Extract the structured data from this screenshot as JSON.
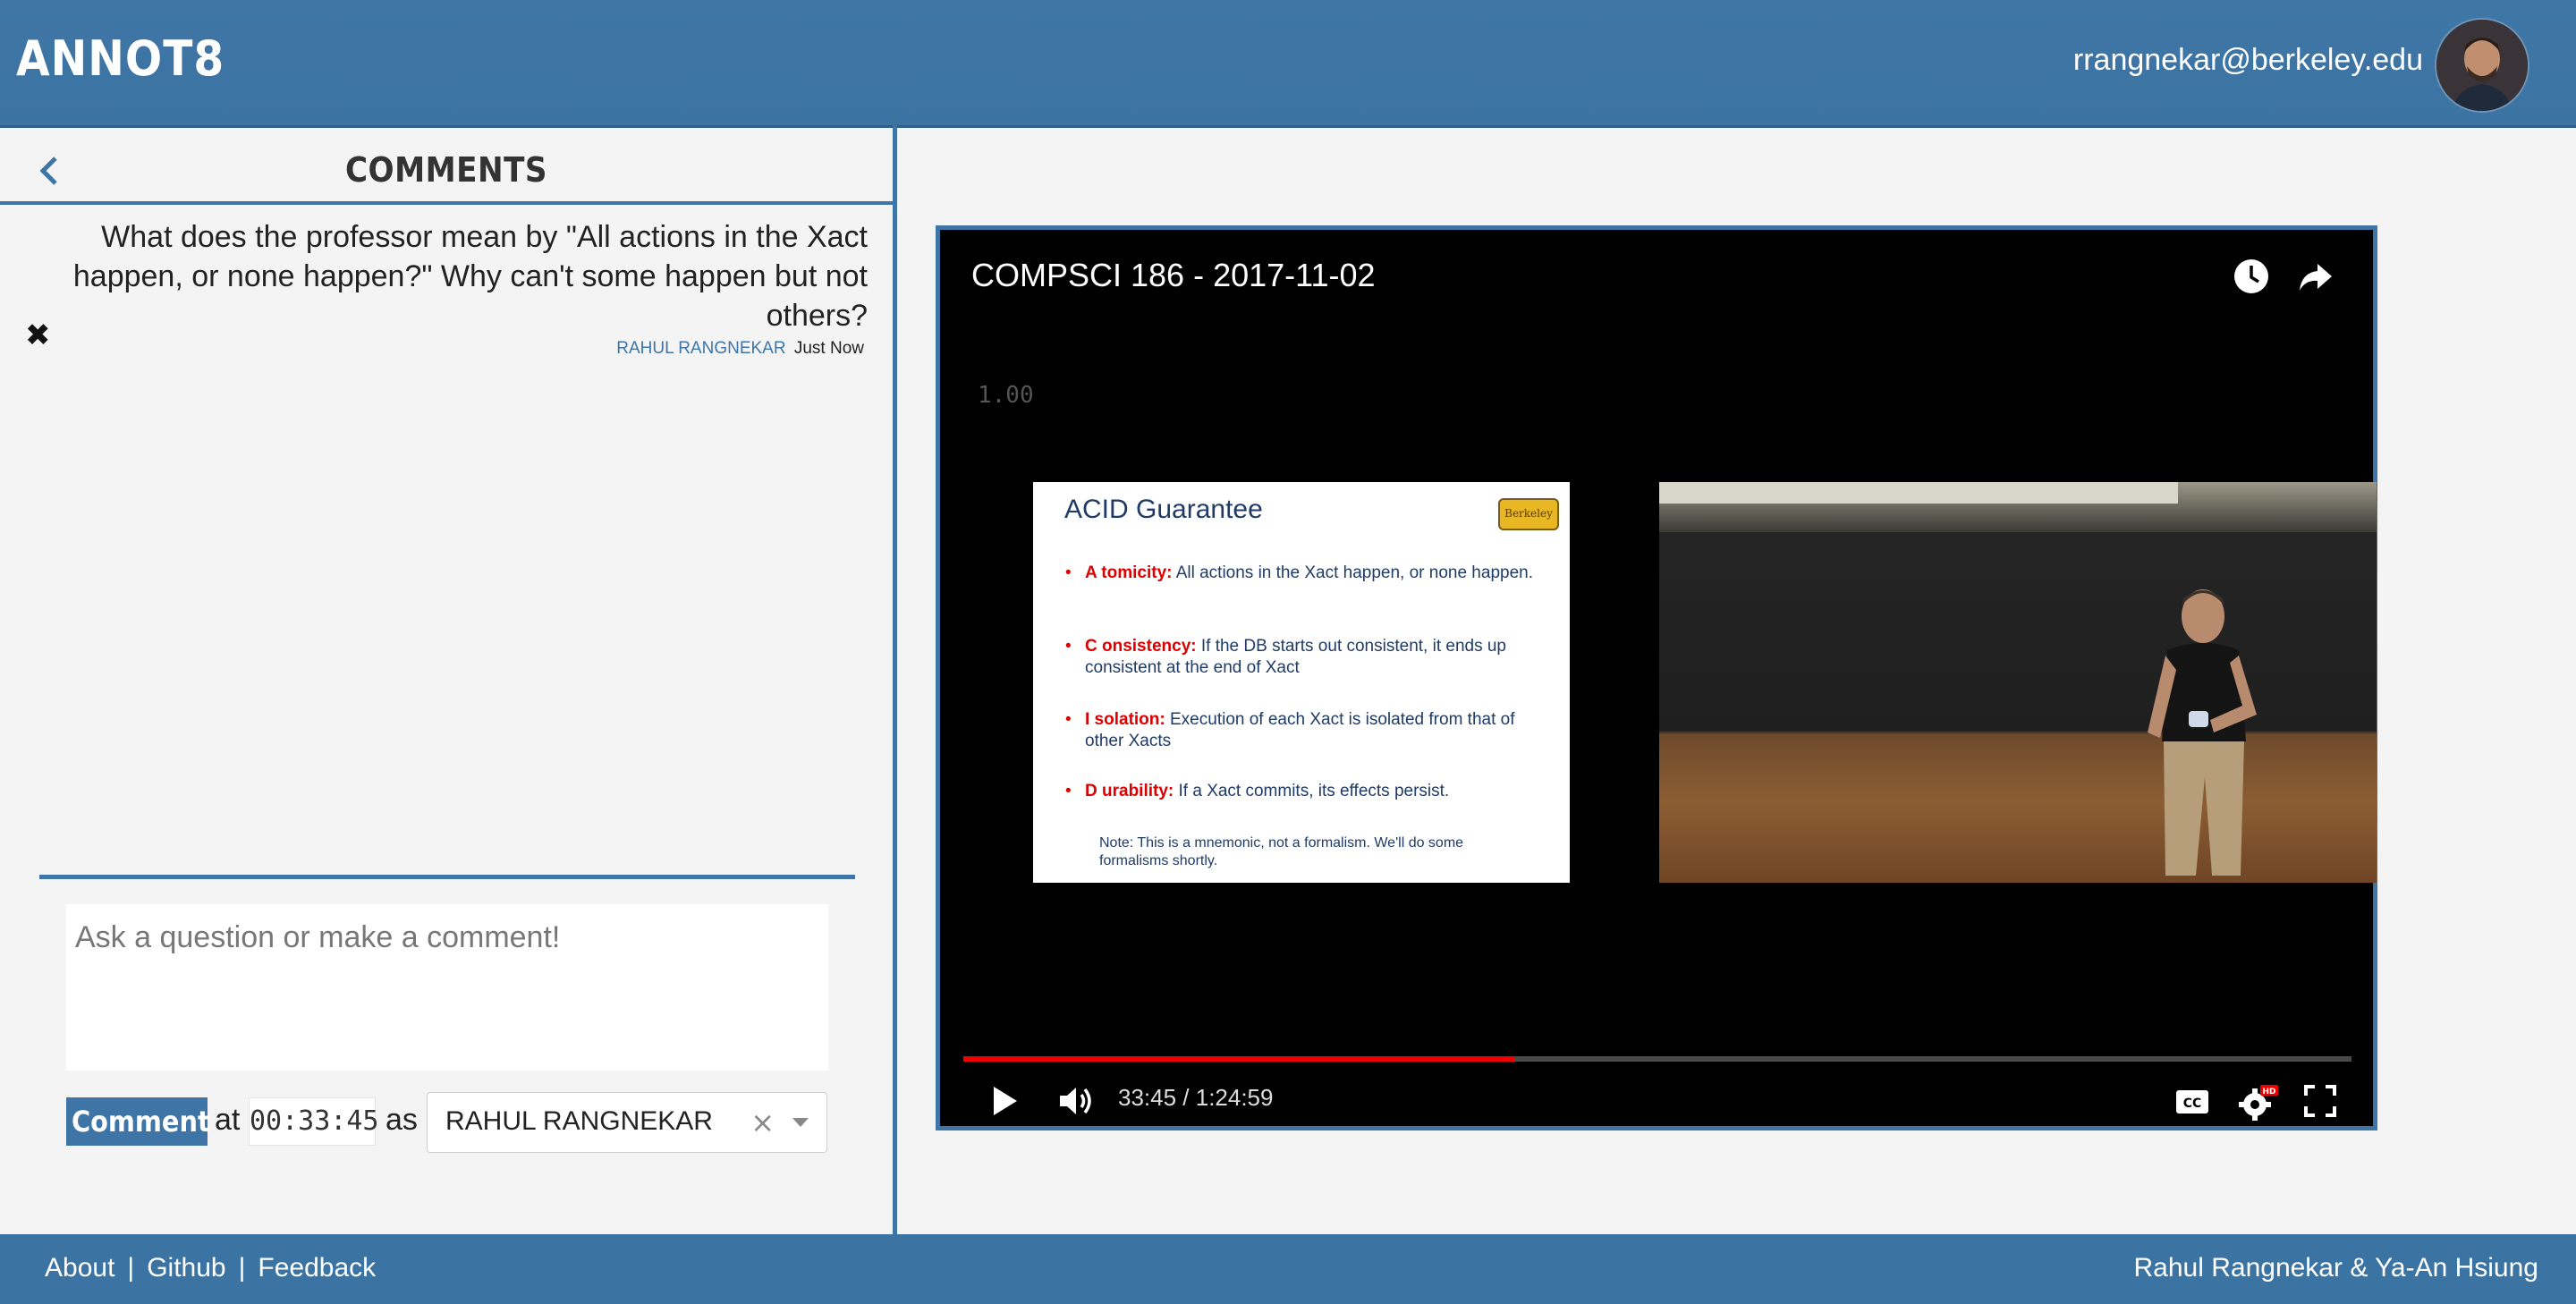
{
  "app": {
    "logo": "ANNOT8",
    "user_email": "rrangnekar@berkeley.edu"
  },
  "comments_panel": {
    "title": "COMMENTS",
    "comments": [
      {
        "text": "What does the professor mean by \"All actions in the Xact happen, or none happen?\" Why can't some happen but not others?",
        "author": "RAHUL RANGNEKAR",
        "time": "Just Now"
      }
    ],
    "input_placeholder": "Ask a question or make a comment!",
    "comment_button": "Comment",
    "at_label": "at",
    "timestamp": "00:33:45",
    "as_label": "as",
    "selected_user": "RAHUL RANGNEKAR"
  },
  "video": {
    "title": "COMPSCI 186 - 2017-11-02",
    "speed": "1.00",
    "current_time": "33:45",
    "duration": "1:24:59",
    "time_display": "33:45 / 1:24:59",
    "progress_fraction": 0.397,
    "slide": {
      "title": "ACID Guarantee",
      "logo_text": "Berkeley",
      "bullets": [
        {
          "key": "A tomicity:",
          "rest": " All actions in the Xact happen, or none happen."
        },
        {
          "key": "C onsistency:",
          "rest": " If the DB starts out consistent, it ends up consistent at the end of Xact"
        },
        {
          "key": "I solation:",
          "rest": " Execution of each Xact is isolated from that of other Xacts"
        },
        {
          "key": "D urability:",
          "rest": " If a Xact commits, its effects persist."
        }
      ],
      "note": "Note: This is a mnemonic, not a formalism. We'll do some formalisms shortly."
    },
    "icons": [
      "watch-later-icon",
      "share-icon",
      "play-icon",
      "volume-icon",
      "cc-icon",
      "settings-icon",
      "fullscreen-icon"
    ]
  },
  "footer": {
    "links": [
      "About",
      "Github",
      "Feedback"
    ],
    "separator": "|",
    "credit": "Rahul Rangnekar & Ya-An Hsiung"
  },
  "colors": {
    "brand": "#3e75a6",
    "progress": "#ee0000"
  }
}
